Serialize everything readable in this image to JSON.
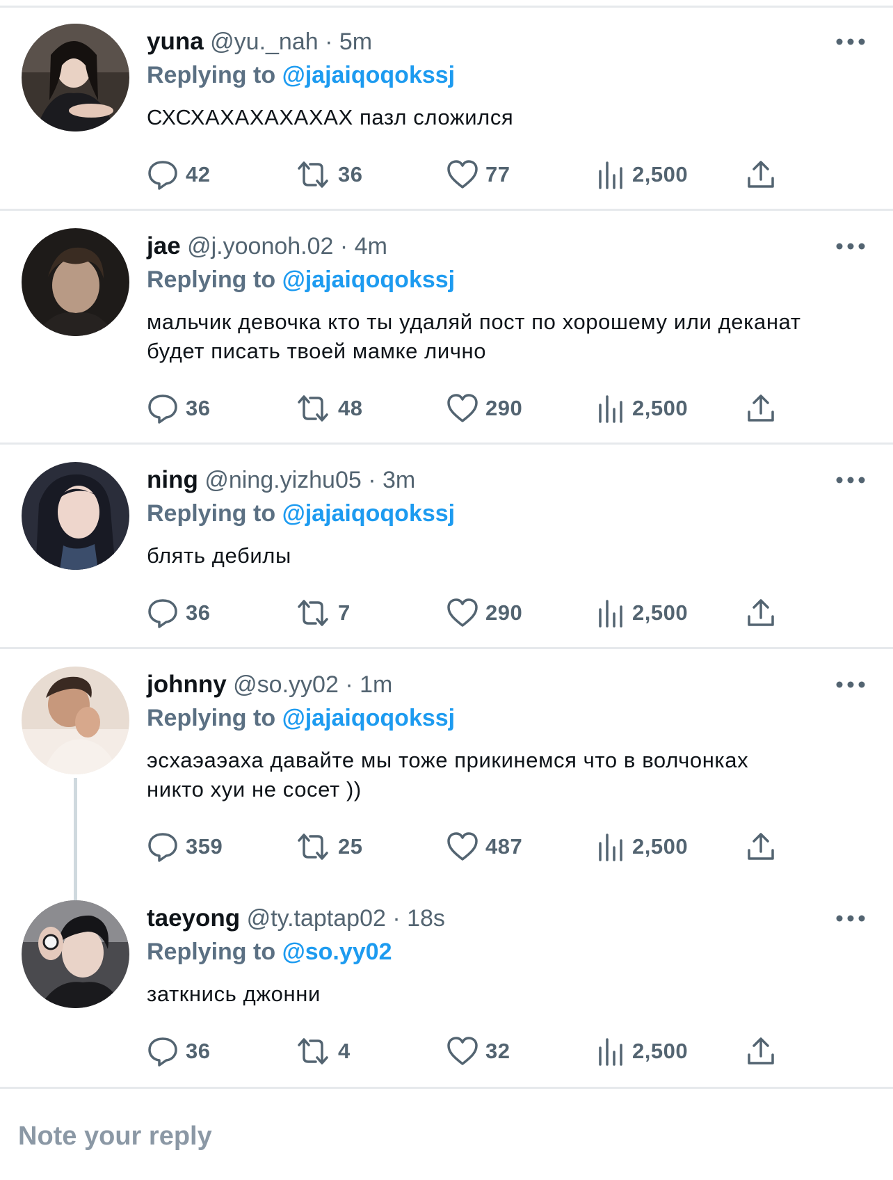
{
  "tweets": [
    {
      "name": "yuna",
      "handle": "@yu._nah",
      "time": "· 5m",
      "replying_label": "Replying to",
      "replying_to": "@jajaiqoqokssj",
      "body": "СХСХАХАХАХАХАХ пазл сложился",
      "replies": "42",
      "retweets": "36",
      "likes": "77",
      "views": "2,500"
    },
    {
      "name": "jae",
      "handle": "@j.yoonoh.02",
      "time": "· 4m",
      "replying_label": "Replying to",
      "replying_to": "@jajaiqoqokssj",
      "body": "мальчик девочка кто ты удаляй пост по хорошему или деканат будет писать твоей мамке лично",
      "replies": "36",
      "retweets": "48",
      "likes": "290",
      "views": "2,500"
    },
    {
      "name": "ning",
      "handle": "@ning.yizhu05",
      "time": "· 3m",
      "replying_label": "Replying to",
      "replying_to": "@jajaiqoqokssj",
      "body": "блять дебилы",
      "replies": "36",
      "retweets": "7",
      "likes": "290",
      "views": "2,500"
    },
    {
      "name": "johnny",
      "handle": "@so.yy02",
      "time": "· 1m",
      "replying_label": "Replying to",
      "replying_to": "@jajaiqoqokssj",
      "body": "эсхаэаэаха давайте мы тоже прикинемся что в волчонках никто хуи не сосет ))",
      "replies": "359",
      "retweets": "25",
      "likes": "487",
      "views": "2,500"
    },
    {
      "name": "taeyong",
      "handle": "@ty.taptap02",
      "time": "· 18s",
      "replying_label": "Replying to",
      "replying_to": "@so.yy02",
      "body": "заткнись джонни",
      "replies": "36",
      "retweets": "4",
      "likes": "32",
      "views": "2,500"
    }
  ],
  "compose": {
    "placeholder": "Note your reply"
  },
  "icons": {
    "reply": "reply-icon",
    "retweet": "retweet-icon",
    "like": "heart-icon",
    "views": "views-icon",
    "share": "share-icon",
    "more": "more-icon"
  },
  "colors": {
    "mention": "#1d9bf0",
    "muted": "#536471",
    "divider": "#e6e9ec"
  }
}
